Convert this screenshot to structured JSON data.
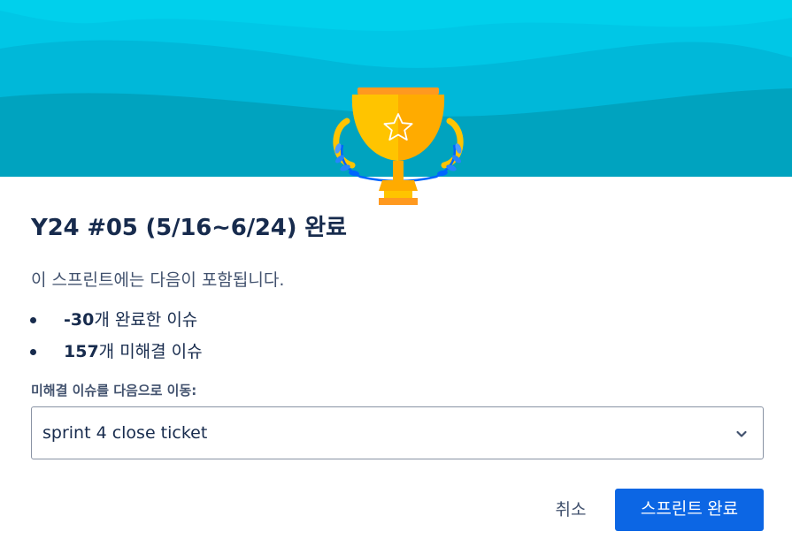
{
  "dialog": {
    "title": "Y24 #05 (5/16~6/24) 완료",
    "description": "이 스프린트에는 다음이 포함됩니다.",
    "issues": [
      {
        "count": "-30",
        "label": "개 완료한 이슈"
      },
      {
        "count": "157",
        "label": "개 미해결 이슈"
      }
    ],
    "move_label": "미해결 이슈를 다음으로 이동:",
    "select": {
      "value": "sprint 4 close ticket"
    },
    "cancel_label": "취소",
    "complete_label": "스프린트 완료"
  },
  "colors": {
    "header_sky": "#00c7e6",
    "primary_button": "#0c66e4",
    "trophy_gold": "#ffab00"
  },
  "icons": {
    "trophy": "trophy-icon",
    "chevron": "chevron-down-icon"
  }
}
